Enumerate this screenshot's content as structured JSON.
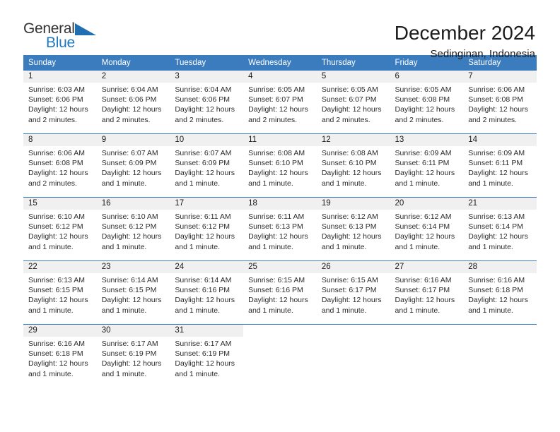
{
  "logo": {
    "word1": "General",
    "word2": "Blue",
    "triangle_color": "#1f6fb2",
    "text_color": "#333333",
    "blue_color": "#1f7ac0"
  },
  "header": {
    "title": "December 2024",
    "subtitle": "Sedinginan, Indonesia"
  },
  "theme": {
    "header_blue": "#3a7cbe",
    "band_gray": "#f0f0f0"
  },
  "weekdays": [
    "Sunday",
    "Monday",
    "Tuesday",
    "Wednesday",
    "Thursday",
    "Friday",
    "Saturday"
  ],
  "labels": {
    "sunrise": "Sunrise:",
    "sunset": "Sunset:",
    "daylight": "Daylight:"
  },
  "weeks": [
    [
      {
        "day": "1",
        "sunrise": "Sunrise: 6:03 AM",
        "sunset": "Sunset: 6:06 PM",
        "daylight1": "Daylight: 12 hours",
        "daylight2": "and 2 minutes."
      },
      {
        "day": "2",
        "sunrise": "Sunrise: 6:04 AM",
        "sunset": "Sunset: 6:06 PM",
        "daylight1": "Daylight: 12 hours",
        "daylight2": "and 2 minutes."
      },
      {
        "day": "3",
        "sunrise": "Sunrise: 6:04 AM",
        "sunset": "Sunset: 6:06 PM",
        "daylight1": "Daylight: 12 hours",
        "daylight2": "and 2 minutes."
      },
      {
        "day": "4",
        "sunrise": "Sunrise: 6:05 AM",
        "sunset": "Sunset: 6:07 PM",
        "daylight1": "Daylight: 12 hours",
        "daylight2": "and 2 minutes."
      },
      {
        "day": "5",
        "sunrise": "Sunrise: 6:05 AM",
        "sunset": "Sunset: 6:07 PM",
        "daylight1": "Daylight: 12 hours",
        "daylight2": "and 2 minutes."
      },
      {
        "day": "6",
        "sunrise": "Sunrise: 6:05 AM",
        "sunset": "Sunset: 6:08 PM",
        "daylight1": "Daylight: 12 hours",
        "daylight2": "and 2 minutes."
      },
      {
        "day": "7",
        "sunrise": "Sunrise: 6:06 AM",
        "sunset": "Sunset: 6:08 PM",
        "daylight1": "Daylight: 12 hours",
        "daylight2": "and 2 minutes."
      }
    ],
    [
      {
        "day": "8",
        "sunrise": "Sunrise: 6:06 AM",
        "sunset": "Sunset: 6:08 PM",
        "daylight1": "Daylight: 12 hours",
        "daylight2": "and 2 minutes."
      },
      {
        "day": "9",
        "sunrise": "Sunrise: 6:07 AM",
        "sunset": "Sunset: 6:09 PM",
        "daylight1": "Daylight: 12 hours",
        "daylight2": "and 1 minute."
      },
      {
        "day": "10",
        "sunrise": "Sunrise: 6:07 AM",
        "sunset": "Sunset: 6:09 PM",
        "daylight1": "Daylight: 12 hours",
        "daylight2": "and 1 minute."
      },
      {
        "day": "11",
        "sunrise": "Sunrise: 6:08 AM",
        "sunset": "Sunset: 6:10 PM",
        "daylight1": "Daylight: 12 hours",
        "daylight2": "and 1 minute."
      },
      {
        "day": "12",
        "sunrise": "Sunrise: 6:08 AM",
        "sunset": "Sunset: 6:10 PM",
        "daylight1": "Daylight: 12 hours",
        "daylight2": "and 1 minute."
      },
      {
        "day": "13",
        "sunrise": "Sunrise: 6:09 AM",
        "sunset": "Sunset: 6:11 PM",
        "daylight1": "Daylight: 12 hours",
        "daylight2": "and 1 minute."
      },
      {
        "day": "14",
        "sunrise": "Sunrise: 6:09 AM",
        "sunset": "Sunset: 6:11 PM",
        "daylight1": "Daylight: 12 hours",
        "daylight2": "and 1 minute."
      }
    ],
    [
      {
        "day": "15",
        "sunrise": "Sunrise: 6:10 AM",
        "sunset": "Sunset: 6:12 PM",
        "daylight1": "Daylight: 12 hours",
        "daylight2": "and 1 minute."
      },
      {
        "day": "16",
        "sunrise": "Sunrise: 6:10 AM",
        "sunset": "Sunset: 6:12 PM",
        "daylight1": "Daylight: 12 hours",
        "daylight2": "and 1 minute."
      },
      {
        "day": "17",
        "sunrise": "Sunrise: 6:11 AM",
        "sunset": "Sunset: 6:12 PM",
        "daylight1": "Daylight: 12 hours",
        "daylight2": "and 1 minute."
      },
      {
        "day": "18",
        "sunrise": "Sunrise: 6:11 AM",
        "sunset": "Sunset: 6:13 PM",
        "daylight1": "Daylight: 12 hours",
        "daylight2": "and 1 minute."
      },
      {
        "day": "19",
        "sunrise": "Sunrise: 6:12 AM",
        "sunset": "Sunset: 6:13 PM",
        "daylight1": "Daylight: 12 hours",
        "daylight2": "and 1 minute."
      },
      {
        "day": "20",
        "sunrise": "Sunrise: 6:12 AM",
        "sunset": "Sunset: 6:14 PM",
        "daylight1": "Daylight: 12 hours",
        "daylight2": "and 1 minute."
      },
      {
        "day": "21",
        "sunrise": "Sunrise: 6:13 AM",
        "sunset": "Sunset: 6:14 PM",
        "daylight1": "Daylight: 12 hours",
        "daylight2": "and 1 minute."
      }
    ],
    [
      {
        "day": "22",
        "sunrise": "Sunrise: 6:13 AM",
        "sunset": "Sunset: 6:15 PM",
        "daylight1": "Daylight: 12 hours",
        "daylight2": "and 1 minute."
      },
      {
        "day": "23",
        "sunrise": "Sunrise: 6:14 AM",
        "sunset": "Sunset: 6:15 PM",
        "daylight1": "Daylight: 12 hours",
        "daylight2": "and 1 minute."
      },
      {
        "day": "24",
        "sunrise": "Sunrise: 6:14 AM",
        "sunset": "Sunset: 6:16 PM",
        "daylight1": "Daylight: 12 hours",
        "daylight2": "and 1 minute."
      },
      {
        "day": "25",
        "sunrise": "Sunrise: 6:15 AM",
        "sunset": "Sunset: 6:16 PM",
        "daylight1": "Daylight: 12 hours",
        "daylight2": "and 1 minute."
      },
      {
        "day": "26",
        "sunrise": "Sunrise: 6:15 AM",
        "sunset": "Sunset: 6:17 PM",
        "daylight1": "Daylight: 12 hours",
        "daylight2": "and 1 minute."
      },
      {
        "day": "27",
        "sunrise": "Sunrise: 6:16 AM",
        "sunset": "Sunset: 6:17 PM",
        "daylight1": "Daylight: 12 hours",
        "daylight2": "and 1 minute."
      },
      {
        "day": "28",
        "sunrise": "Sunrise: 6:16 AM",
        "sunset": "Sunset: 6:18 PM",
        "daylight1": "Daylight: 12 hours",
        "daylight2": "and 1 minute."
      }
    ],
    [
      {
        "day": "29",
        "sunrise": "Sunrise: 6:16 AM",
        "sunset": "Sunset: 6:18 PM",
        "daylight1": "Daylight: 12 hours",
        "daylight2": "and 1 minute."
      },
      {
        "day": "30",
        "sunrise": "Sunrise: 6:17 AM",
        "sunset": "Sunset: 6:19 PM",
        "daylight1": "Daylight: 12 hours",
        "daylight2": "and 1 minute."
      },
      {
        "day": "31",
        "sunrise": "Sunrise: 6:17 AM",
        "sunset": "Sunset: 6:19 PM",
        "daylight1": "Daylight: 12 hours",
        "daylight2": "and 1 minute."
      },
      {
        "day": "",
        "sunrise": "",
        "sunset": "",
        "daylight1": "",
        "daylight2": ""
      },
      {
        "day": "",
        "sunrise": "",
        "sunset": "",
        "daylight1": "",
        "daylight2": ""
      },
      {
        "day": "",
        "sunrise": "",
        "sunset": "",
        "daylight1": "",
        "daylight2": ""
      },
      {
        "day": "",
        "sunrise": "",
        "sunset": "",
        "daylight1": "",
        "daylight2": ""
      }
    ]
  ]
}
